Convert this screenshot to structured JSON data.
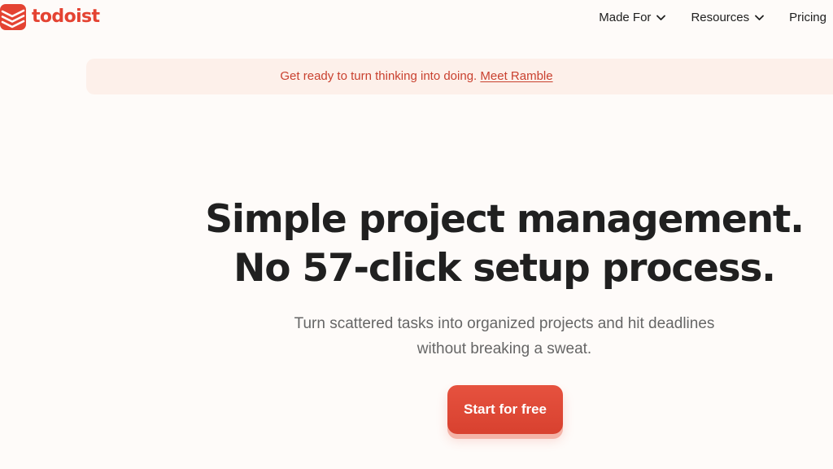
{
  "brand": {
    "name": "todoist",
    "logo_icon": "todoist-layers-icon",
    "color": "#e44332"
  },
  "nav": {
    "items": [
      {
        "label": "Made For",
        "icon": "chevron-down-icon"
      },
      {
        "label": "Resources",
        "icon": "chevron-down-icon"
      },
      {
        "label": "Pricing"
      }
    ]
  },
  "banner": {
    "text": "Get ready to turn thinking into doing.",
    "link_label": "Meet Ramble",
    "text_color": "#c9412f",
    "background": "#fdf0ea"
  },
  "hero": {
    "title_line1": "Simple project management.",
    "title_line2": "No 57-click setup process.",
    "subtitle_line1": "Turn scattered tasks into organized projects and hit deadlines",
    "subtitle_line2": "without breaking a sweat.",
    "cta_label": "Start for free"
  },
  "colors": {
    "page_background": "#fefbf9",
    "heading": "#202020",
    "subtitle": "#666666",
    "accent": "#e44332"
  }
}
